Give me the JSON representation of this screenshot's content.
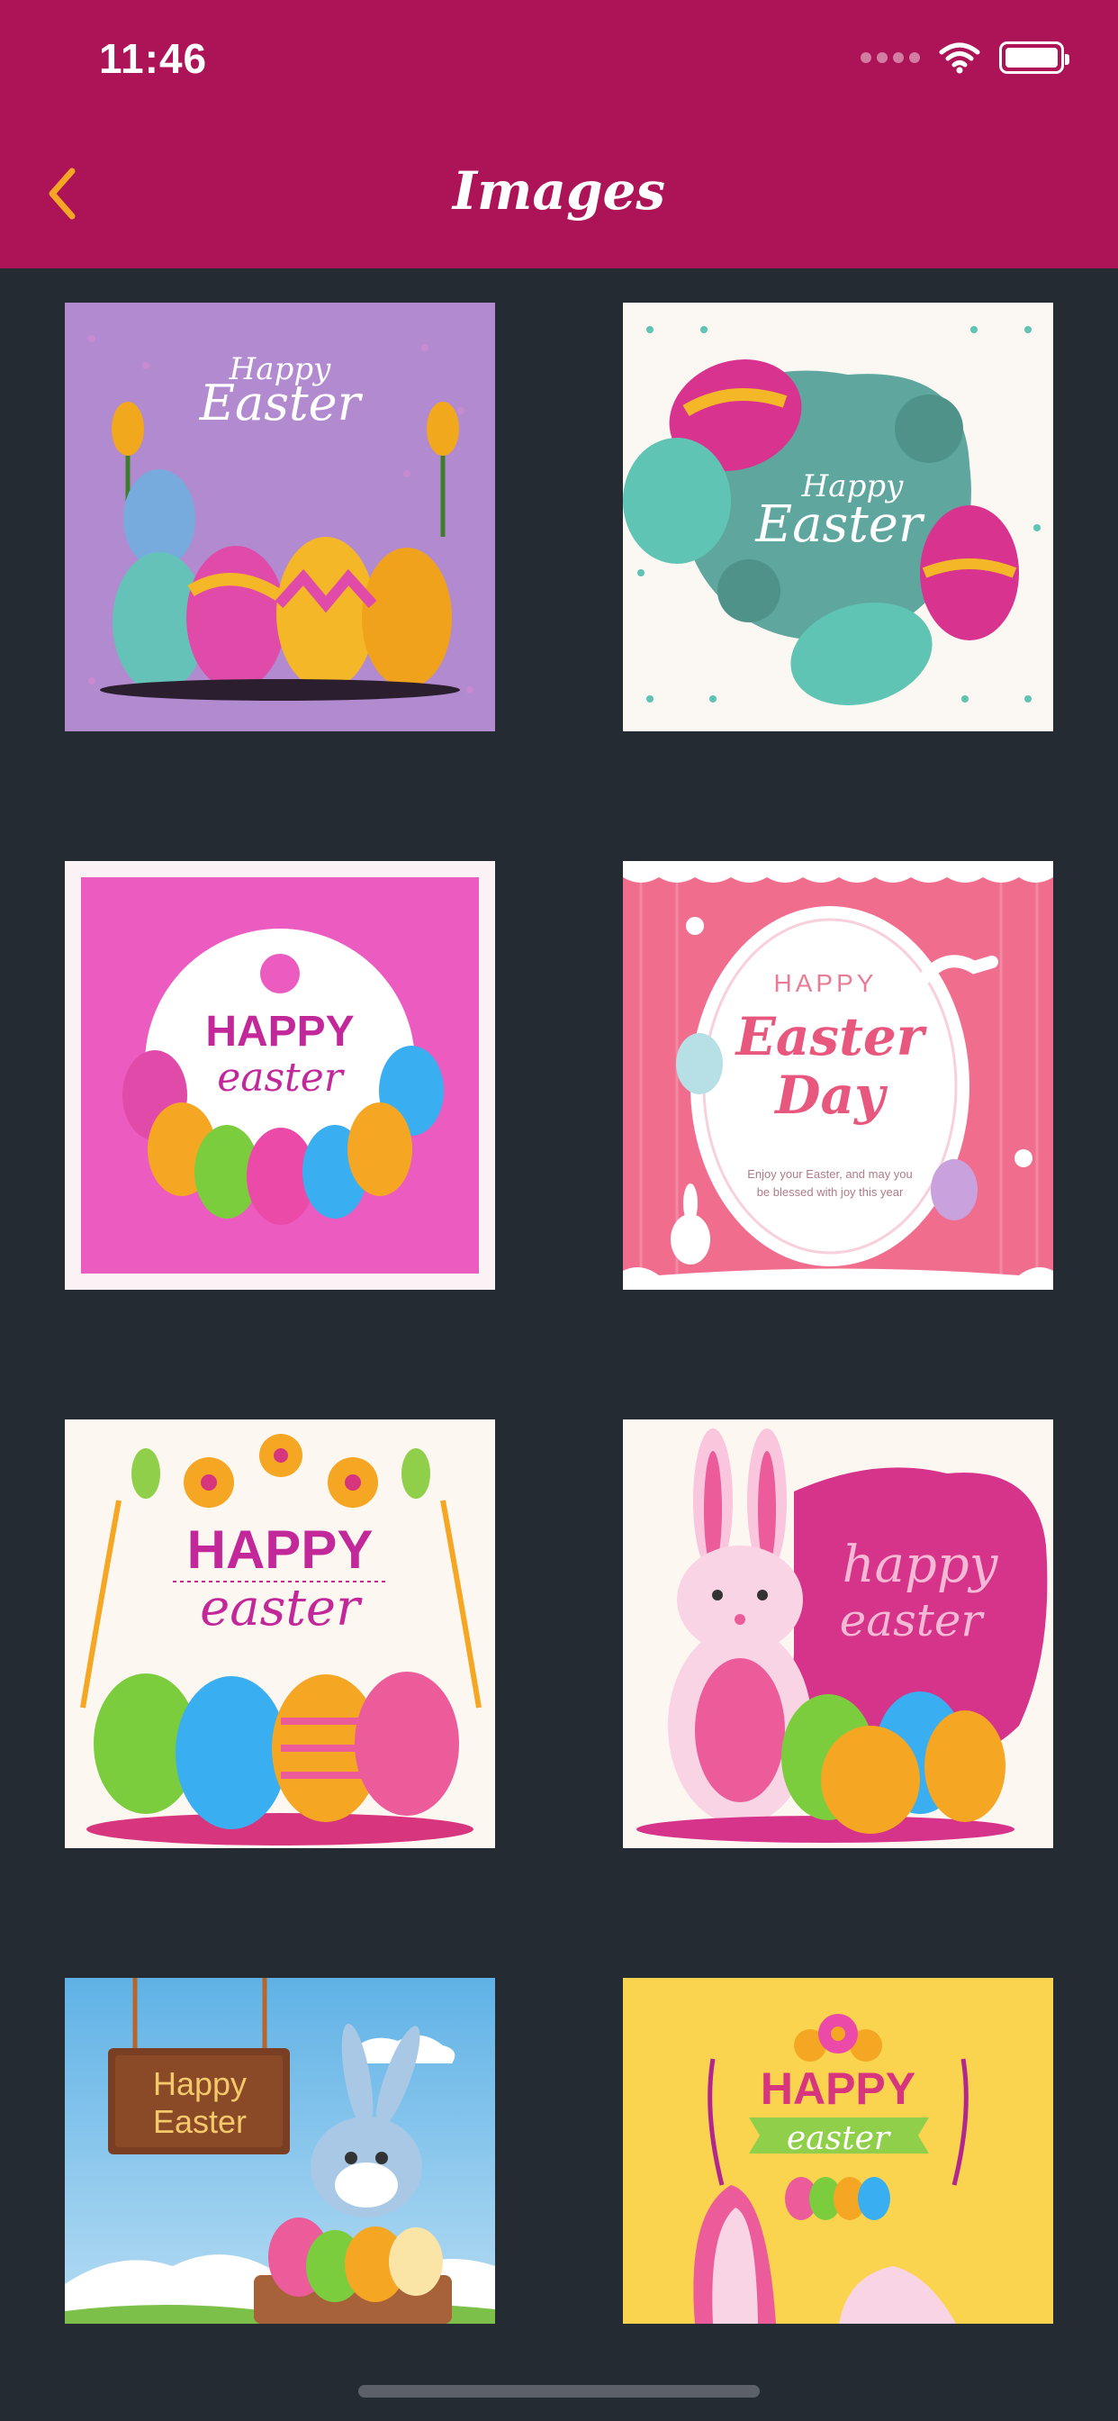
{
  "status_bar": {
    "time": "11:46"
  },
  "nav": {
    "title": "Images"
  },
  "images": [
    {
      "lines": [
        "Happy",
        "Easter"
      ]
    },
    {
      "lines": [
        "Happy",
        "Easter"
      ]
    },
    {
      "lines": [
        "HAPPY",
        "easter"
      ]
    },
    {
      "lines": [
        "HAPPY",
        "Easter",
        "Day",
        "Enjoy your Easter, and may you",
        "be blessed with joy this year"
      ]
    },
    {
      "lines": [
        "HAPPY",
        "easter"
      ]
    },
    {
      "lines": [
        "happy",
        "easter"
      ]
    },
    {
      "lines": [
        "Happy",
        "Easter"
      ]
    },
    {
      "lines": [
        "HAPPY",
        "easter"
      ]
    }
  ],
  "colors": {
    "header": "#ad1457",
    "background": "#252b33",
    "back_chevron": "#f5a623"
  }
}
